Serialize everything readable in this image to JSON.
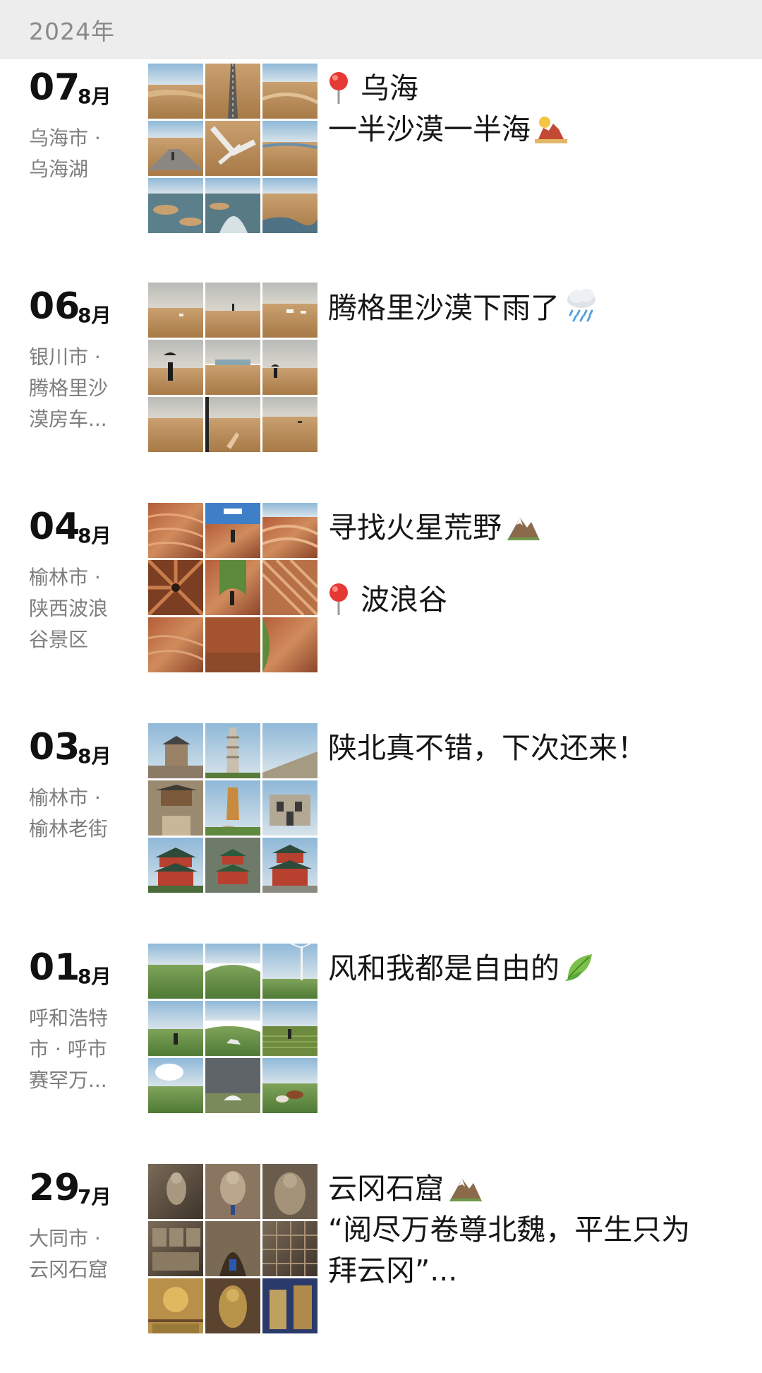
{
  "header": {
    "year": "2024年"
  },
  "entries": [
    {
      "day": "07",
      "month": "8月",
      "location": "乌海市 · 乌海湖",
      "caption": {
        "location_tag": "乌海",
        "text": "一半沙漠一半海",
        "emoji": "desert-island-icon"
      }
    },
    {
      "day": "06",
      "month": "8月",
      "location": "银川市 · 腾格里沙漠房车...",
      "caption": {
        "text": "腾格里沙漠下雨了",
        "emoji": "rain-cloud-icon"
      }
    },
    {
      "day": "04",
      "month": "8月",
      "location": "榆林市 · 陕西波浪谷景区",
      "caption": {
        "text": "寻找火星荒野",
        "emoji": "mountain-icon",
        "location_tag": "波浪谷"
      }
    },
    {
      "day": "03",
      "month": "8月",
      "location": "榆林市 · 榆林老街",
      "caption": {
        "text": "陕北真不错，下次还来！"
      }
    },
    {
      "day": "01",
      "month": "8月",
      "location": "呼和浩特市 · 呼市赛罕万...",
      "caption": {
        "text": "风和我都是自由的",
        "emoji": "leaf-icon"
      }
    },
    {
      "day": "29",
      "month": "7月",
      "location": "大同市 · 云冈石窟",
      "caption": {
        "text": "云冈石窟",
        "emoji": "mountain-icon",
        "quote_line1": "“阅尽万卷尊北魏，平生只为",
        "quote_line2": "拜云冈”..."
      }
    }
  ],
  "colors": {
    "header_bg": "#ededed",
    "date_text": "#111111",
    "location_text": "#7d7d7d",
    "pin_red": "#e53935"
  }
}
